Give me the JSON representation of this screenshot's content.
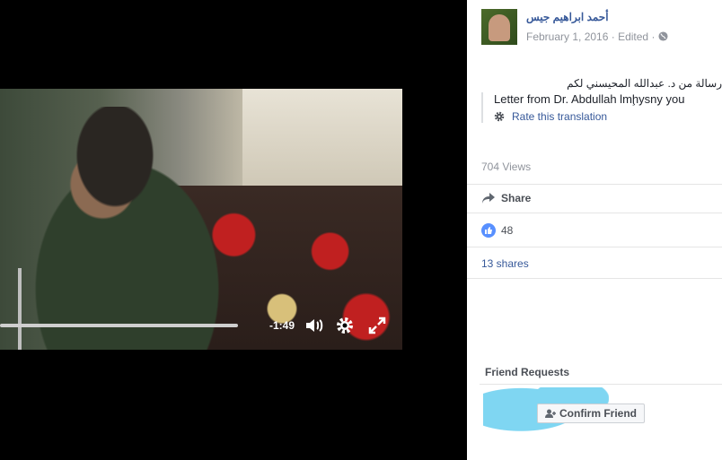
{
  "post": {
    "author": "أحمد ابراهيم جيس",
    "date": "February 1, 2016",
    "edited": "Edited",
    "arabic_text": "رسالة من د. عبدالله المحيسني لكم",
    "translation": "Letter from Dr. Abdullah lmḩysny you",
    "rate_translation": "Rate this translation",
    "views": "704 Views",
    "share_label": "Share",
    "like_count": "48",
    "shares": "13 shares"
  },
  "video": {
    "time_remaining": "-1:49",
    "progress": 0.59
  },
  "friend_requests": {
    "title": "Friend Requests",
    "confirm_label": "Confirm Friend"
  },
  "icons": {
    "volume": "volume-icon",
    "settings": "gear-icon",
    "fullscreen": "fullscreen-icon",
    "share": "share-arrow-icon",
    "like": "thumbs-up-icon",
    "globe": "globe-icon",
    "add_friend": "add-friend-icon"
  },
  "colors": {
    "link": "#365899",
    "like_blue": "#5890ff",
    "muted": "#90949c"
  }
}
